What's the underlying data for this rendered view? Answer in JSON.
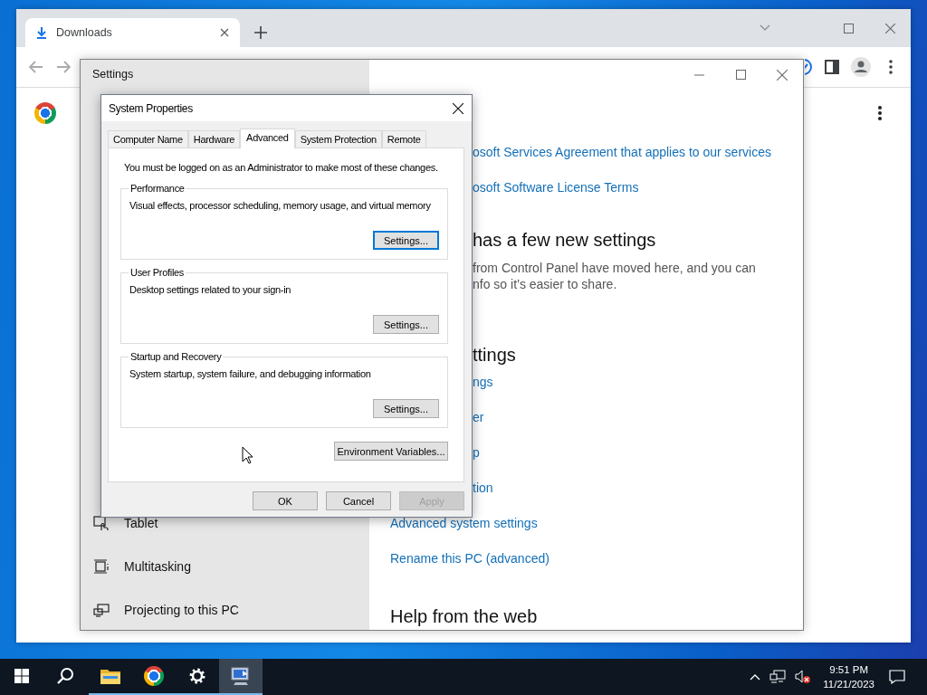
{
  "browser": {
    "tabs": [
      {
        "title": "Downloads",
        "selected": true
      }
    ]
  },
  "settings_window": {
    "title": "Settings",
    "sidebar": {
      "items": [
        {
          "label": "Tablet",
          "kind": "tablet"
        },
        {
          "label": "Multitasking",
          "kind": "multitasking"
        },
        {
          "label": "Projecting to this PC",
          "kind": "projecting"
        }
      ]
    },
    "sections": [
      {
        "links": [
          {
            "text": "osoft Services Agreement that applies to our services",
            "covered": true
          },
          {
            "text": "osoft Software License Terms",
            "covered": true
          }
        ]
      },
      {
        "heading": "has a few new settings",
        "heading_covered": true,
        "text_lines": [
          "from Control Panel have moved here, and you can",
          "nfo so it’s easier to share."
        ]
      },
      {
        "heading": "ttings",
        "heading_covered": true,
        "links": [
          {
            "text": "ngs",
            "covered": true
          },
          {
            "text": "er",
            "covered": true
          },
          {
            "text": "p",
            "covered": true
          },
          {
            "text": "tion",
            "covered": true
          },
          {
            "text": "Advanced system settings",
            "covered": false
          },
          {
            "text": "Rename this PC (advanced)",
            "covered": false
          }
        ]
      },
      {
        "heading": "Help from the web",
        "heading_covered": false
      }
    ]
  },
  "dialog": {
    "title": "System Properties",
    "tabs": [
      {
        "label": "Computer Name",
        "selected": false
      },
      {
        "label": "Hardware",
        "selected": false
      },
      {
        "label": "Advanced",
        "selected": true
      },
      {
        "label": "System Protection",
        "selected": false
      },
      {
        "label": "Remote",
        "selected": false
      }
    ],
    "notice": "You must be logged on as an Administrator to make most of these changes.",
    "groups": [
      {
        "title": "Performance",
        "description": "Visual effects, processor scheduling, memory usage, and virtual memory",
        "button": {
          "label": "Settings...",
          "focused": true
        }
      },
      {
        "title": "User Profiles",
        "description": "Desktop settings related to your sign-in",
        "button": {
          "label": "Settings...",
          "focused": false
        }
      },
      {
        "title": "Startup and Recovery",
        "description": "System startup, system failure, and debugging information",
        "button": {
          "label": "Settings...",
          "focused": false
        }
      }
    ],
    "extra_button": "Environment Variables...",
    "buttons": [
      {
        "label": "OK",
        "disabled": false
      },
      {
        "label": "Cancel",
        "disabled": false
      },
      {
        "label": "Apply",
        "disabled": true
      }
    ]
  },
  "taskbar": {
    "items": [
      {
        "kind": "start",
        "running": false,
        "active": false
      },
      {
        "kind": "search",
        "running": false,
        "active": false
      },
      {
        "kind": "explorer",
        "running": true,
        "active": false
      },
      {
        "kind": "browser",
        "running": true,
        "active": false
      },
      {
        "kind": "settings",
        "running": true,
        "active": false
      },
      {
        "kind": "system",
        "running": true,
        "active": true
      }
    ],
    "time": "9:51 PM",
    "date": "11/21/2023"
  }
}
